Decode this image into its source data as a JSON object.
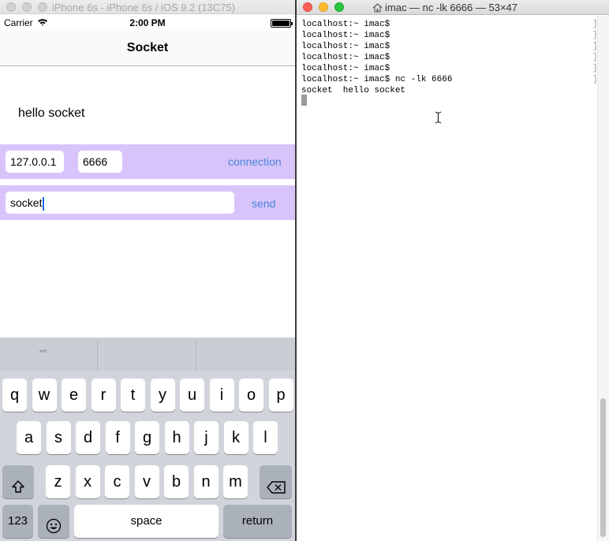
{
  "simulator": {
    "window_title": "iPhone 6s - iPhone 6s / iOS 9.2 (13C75)",
    "status": {
      "carrier": "Carrier",
      "time": "2:00 PM"
    },
    "nav_title": "Socket",
    "received_text": "hello socket",
    "host_field": "127.0.0.1",
    "port_field": "6666",
    "connect_label": "connection",
    "message_field": "socket",
    "send_label": "send",
    "colors": {
      "panel": "#d8c4fb",
      "link": "#4a86d9"
    },
    "keyboard": {
      "suggestion": "“”",
      "row1": [
        "q",
        "w",
        "e",
        "r",
        "t",
        "y",
        "u",
        "i",
        "o",
        "p"
      ],
      "row2": [
        "a",
        "s",
        "d",
        "f",
        "g",
        "h",
        "j",
        "k",
        "l"
      ],
      "row3": [
        "z",
        "x",
        "c",
        "v",
        "b",
        "n",
        "m"
      ],
      "numbers_label": "123",
      "space_label": "space",
      "return_label": "return"
    }
  },
  "terminal": {
    "window_title": "imac — nc -lk 6666 — 53×47",
    "lines": [
      "localhost:~ imac$",
      "localhost:~ imac$",
      "localhost:~ imac$",
      "localhost:~ imac$",
      "localhost:~ imac$",
      "localhost:~ imac$ nc -lk 6666",
      "socket  hello socket"
    ]
  }
}
